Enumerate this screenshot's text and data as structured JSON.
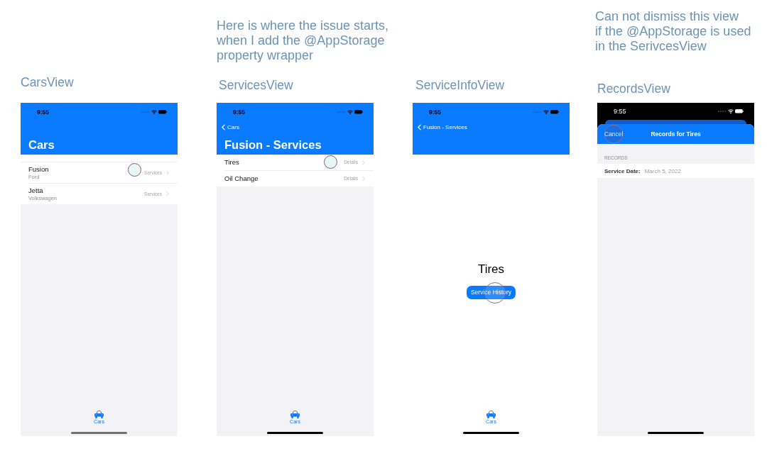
{
  "panels": [
    {
      "kind": "list",
      "caption": "CarsView",
      "status_bar": {
        "time": "9:55"
      },
      "nav_bar": {
        "title": "Cars"
      },
      "rows": [
        {
          "title": "Fusion",
          "subtitle": "Ford",
          "detail": "Services",
          "tapped": true
        },
        {
          "title": "Jetta",
          "subtitle": "Volkswagen",
          "detail": "Services",
          "tapped": false
        }
      ],
      "tab_bar": {
        "items": [
          {
            "label": "Cars",
            "selected": true
          }
        ]
      }
    },
    {
      "kind": "list",
      "note": "Here is where the issue starts,\nwhen I add the @AppStorage\nproperty wrapper",
      "caption": "ServicesView",
      "status_bar": {
        "time": "9:55"
      },
      "nav_bar": {
        "back": "Cars",
        "title": "Fusion - Services"
      },
      "rows": [
        {
          "title": "Tires",
          "detail": "Details",
          "tapped": true
        },
        {
          "title": "Oil Change",
          "detail": "Details",
          "tapped": false
        }
      ],
      "tab_bar": {
        "items": [
          {
            "label": "Cars",
            "selected": true
          }
        ]
      }
    },
    {
      "kind": "detail",
      "caption": "ServiceInfoView",
      "status_bar": {
        "time": "9:55"
      },
      "nav_bar": {
        "back": "Fusion - Services"
      },
      "heading": "Tires",
      "button": {
        "label": "Service History",
        "tapped": true
      },
      "tab_bar": {
        "items": [
          {
            "label": "Cars",
            "selected": true
          }
        ]
      }
    },
    {
      "kind": "sheet",
      "note": "Can not dismiss this view\nif the @AppStorage is used\nin the SerivcesView",
      "caption": "RecordsView",
      "status_bar": {
        "time": "9:55"
      },
      "sheet_bar": {
        "cancel": {
          "label": "Cancel",
          "tapped": true
        },
        "title": "Records for Tires"
      },
      "section_header": "RECORDS",
      "fields": [
        {
          "label": "Service Date:",
          "value": "March 5, 2022"
        }
      ]
    }
  ]
}
